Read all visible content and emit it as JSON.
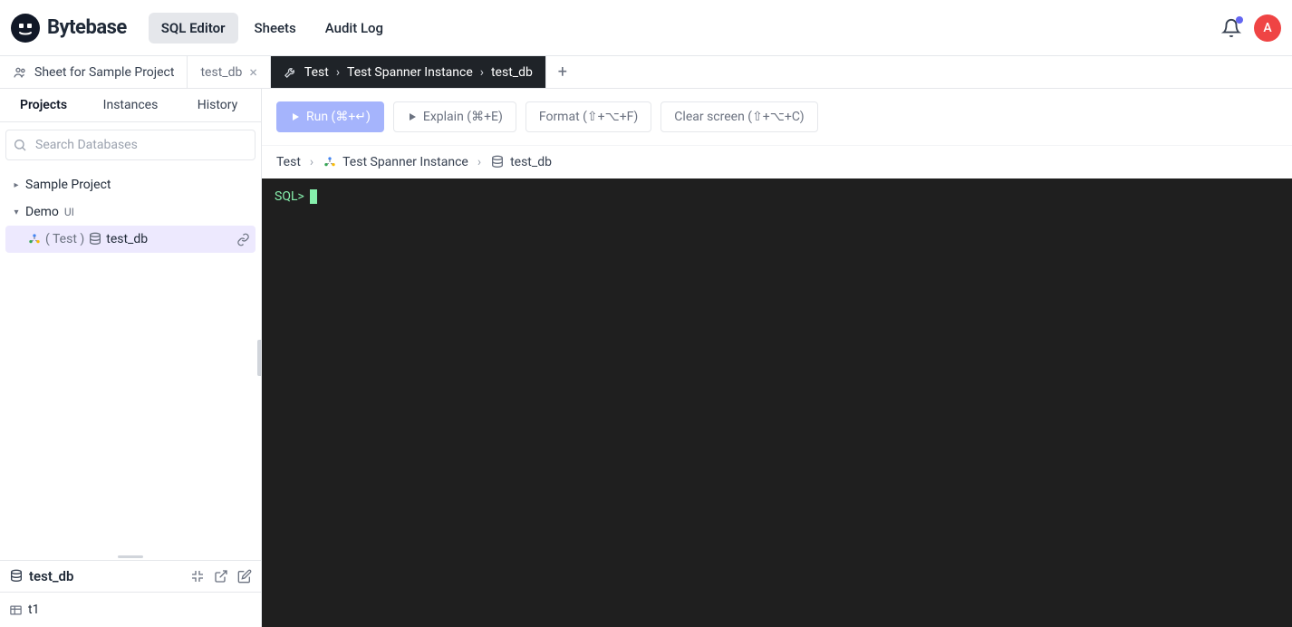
{
  "header": {
    "logo_text": "Bytebase",
    "nav": [
      "SQL Editor",
      "Sheets",
      "Audit Log"
    ],
    "active_nav": 0,
    "avatar_letter": "A"
  },
  "tabs": {
    "sheet_tab": "Sheet for Sample Project",
    "untitled_tab": "test_db",
    "active": {
      "env": "Test",
      "instance": "Test Spanner Instance",
      "db": "test_db"
    }
  },
  "sidebar": {
    "tabs": [
      "Projects",
      "Instances",
      "History"
    ],
    "active_tab": 0,
    "search_placeholder": "Search Databases",
    "tree": {
      "p1": "Sample Project",
      "p2": "Demo",
      "p2_tag": "UI",
      "db_env": "( Test )",
      "db_name": "test_db"
    },
    "lower": {
      "title": "test_db",
      "table": "t1"
    }
  },
  "toolbar": {
    "run": "Run (⌘+↵)",
    "explain": "Explain (⌘+E)",
    "format": "Format (⇧+⌥+F)",
    "clear": "Clear screen (⇧+⌥+C)"
  },
  "crumbs": {
    "env": "Test",
    "instance": "Test Spanner Instance",
    "db": "test_db"
  },
  "terminal": {
    "prompt": "SQL>"
  }
}
